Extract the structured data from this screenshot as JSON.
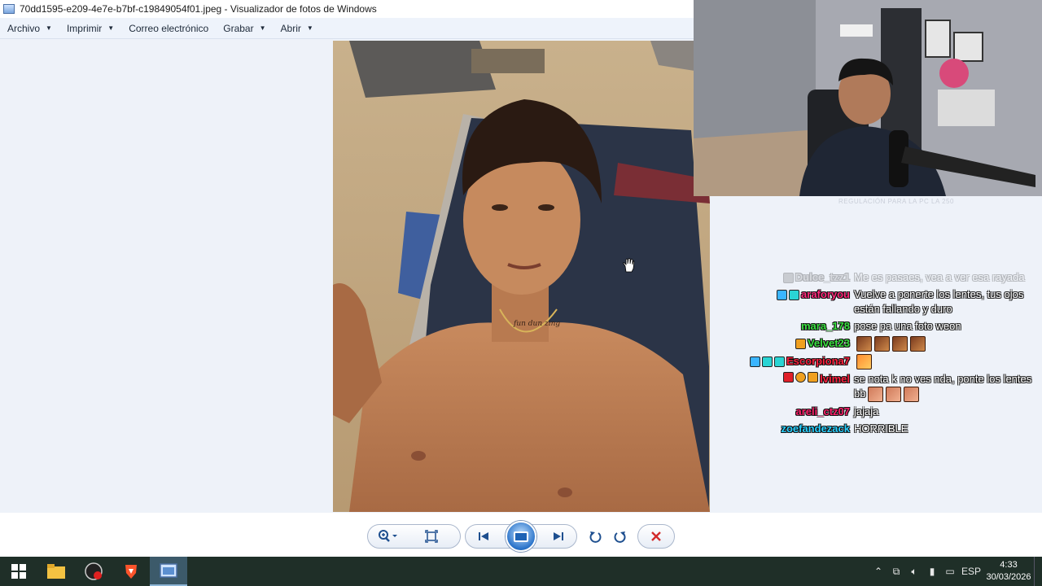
{
  "window": {
    "title": "70dd1595-e209-4e7e-b7bf-c19849054f01.jpeg - Visualizador de fotos de Windows"
  },
  "menu": {
    "items": [
      {
        "label": "Archivo",
        "has_dropdown": true
      },
      {
        "label": "Imprimir",
        "has_dropdown": true
      },
      {
        "label": "Correo electrónico",
        "has_dropdown": false
      },
      {
        "label": "Grabar",
        "has_dropdown": true
      },
      {
        "label": "Abrir",
        "has_dropdown": true
      }
    ]
  },
  "photo": {
    "tattoo_text": "fun dun zing"
  },
  "webcam": {
    "caption": "REGULACIÓN PARA LA PC LA 250"
  },
  "chat": {
    "messages": [
      {
        "user": "Dulce_tzz1",
        "text": "Me es pasaes, vea a ver esa rayada",
        "color": "#a0a0a0",
        "faded": true
      },
      {
        "user": "araforyou",
        "text": "Vuelve a ponerte los lentes, tus ojos están fallando y duro",
        "color": "#ff2a7a",
        "faded": false
      },
      {
        "user": "mara_178",
        "text": "pose pa una foto weon",
        "color": "#39e040",
        "faded": false
      },
      {
        "user": "Velvet23",
        "text": "",
        "color": "#39e040",
        "faded": false
      },
      {
        "user": "Escorpiona7",
        "text": "",
        "color": "#ff1f3d",
        "faded": false
      },
      {
        "user": "lvimel",
        "text": "se nota k no ves nda, ponte los lentes bb",
        "color": "#ff1f3d",
        "faded": false
      },
      {
        "user": "areli_ctz07",
        "text": "jajaja",
        "color": "#ff1f6b",
        "faded": false
      },
      {
        "user": "zoefandezack",
        "text": "HORRIBLE",
        "color": "#28d0ff",
        "faded": false
      }
    ]
  },
  "controls": {
    "zoom_icon": "magnifier-icon",
    "fit_icon": "actual-size-icon",
    "prev_icon": "previous-icon",
    "slideshow_icon": "slideshow-icon",
    "next_icon": "next-icon",
    "rotate_left_icon": "rotate-counterclockwise-icon",
    "rotate_right_icon": "rotate-clockwise-icon",
    "delete_icon": "delete-icon"
  },
  "taskbar": {
    "language": "ESP",
    "time": "4:33",
    "date": "30/03/2026"
  },
  "colors": {
    "accent": "#2a73c9",
    "taskbar": "#1f2f28",
    "viewer_bg": "#eef2f9"
  }
}
